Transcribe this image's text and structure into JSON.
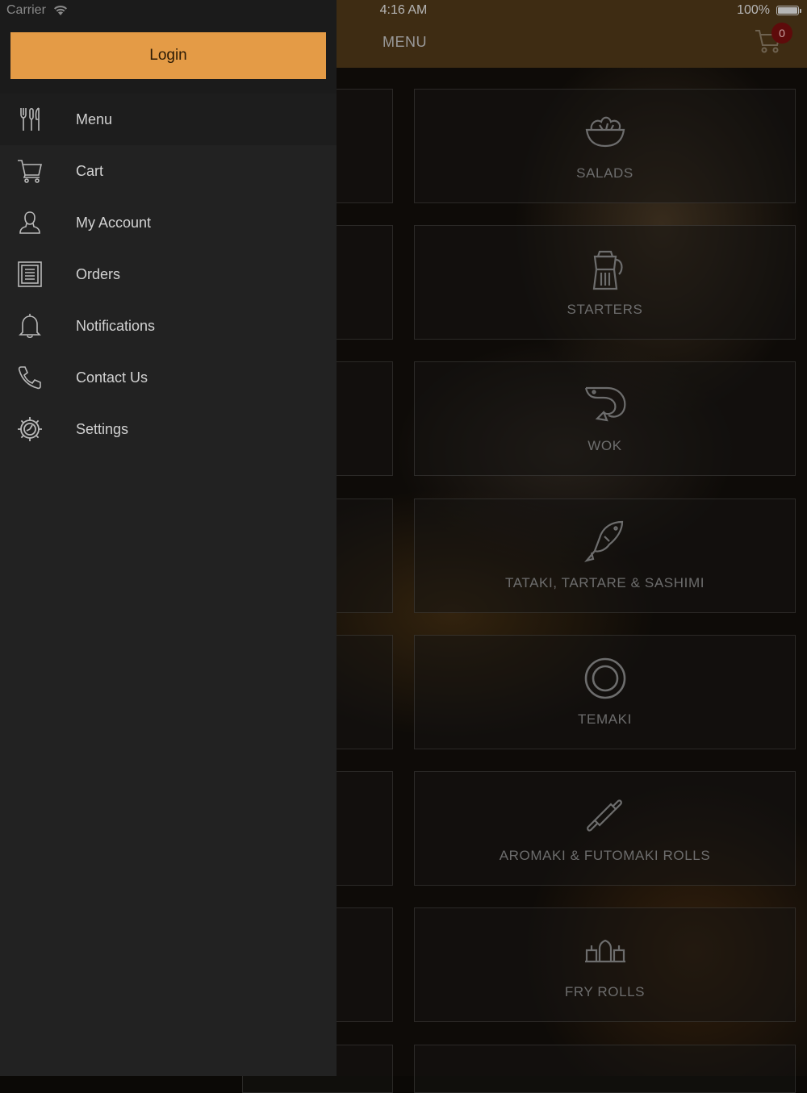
{
  "status_bar": {
    "carrier": "Carrier",
    "time": "4:16 AM",
    "battery": "100%"
  },
  "header": {
    "title": "MENU",
    "cart_count": "0"
  },
  "categories": [
    {
      "label": "SALADS",
      "icon": "salad-bowl-icon"
    },
    {
      "label": "STARTERS",
      "icon": "teapot-icon"
    },
    {
      "label": "WOK",
      "icon": "shrimp-icon"
    },
    {
      "label": "TATAKI, TARTARE & SASHIMI",
      "icon": "fish-icon"
    },
    {
      "label": "TEMAKI",
      "icon": "plate-icon"
    },
    {
      "label": "AROMAKI & FUTOMAKI ROLLS",
      "icon": "rolling-pin-icon"
    },
    {
      "label": "FRY ROLLS",
      "icon": "sushi-rolls-icon"
    }
  ],
  "drawer": {
    "login_label": "Login",
    "items": [
      {
        "label": "Menu",
        "icon": "utensils-icon"
      },
      {
        "label": "Cart",
        "icon": "cart-icon"
      },
      {
        "label": "My Account",
        "icon": "user-icon"
      },
      {
        "label": "Orders",
        "icon": "orders-list-icon"
      },
      {
        "label": "Notifications",
        "icon": "bell-icon"
      },
      {
        "label": "Contact Us",
        "icon": "phone-icon"
      },
      {
        "label": "Settings",
        "icon": "gear-icon"
      }
    ]
  },
  "colors": {
    "accent": "#e49b46",
    "header": "#3e2c13",
    "drawer": "#222222",
    "badge": "#5e0b0b"
  }
}
